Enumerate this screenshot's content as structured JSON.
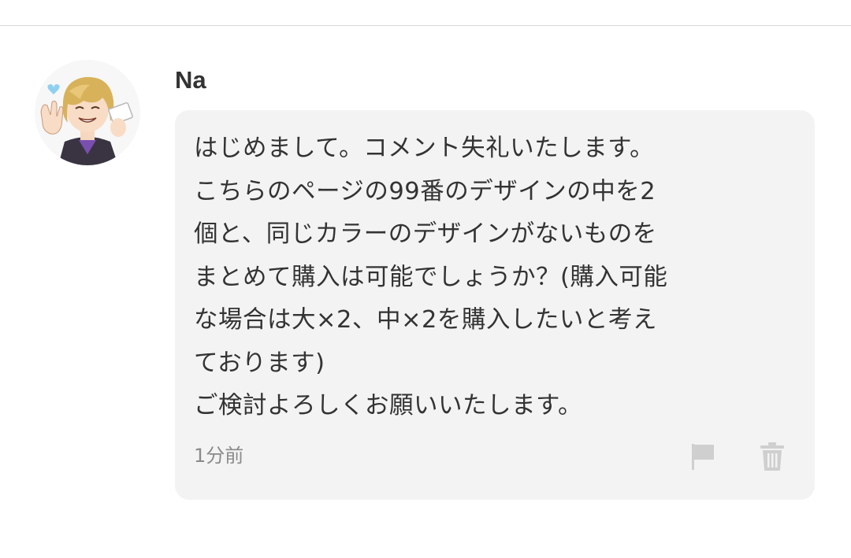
{
  "comment": {
    "author": "Na",
    "text": "はじめまして。コメント失礼いたします。\nこちらのページの99番のデザインの中を2\n個と、同じカラーのデザインがないものを\nまとめて購入は可能でしょうか？(購入可能\nな場合は大×2、中×2を購入したいと考え\nております)\nご検討よろしくお願いいたします。",
    "timestamp": "1分前",
    "actions": {
      "report_icon": "flag-icon",
      "delete_icon": "trash-icon"
    }
  },
  "colors": {
    "bubble_background": "#f3f3f3",
    "text": "#333333",
    "muted": "#8a8a8a",
    "icon": "#cfcfcf"
  }
}
